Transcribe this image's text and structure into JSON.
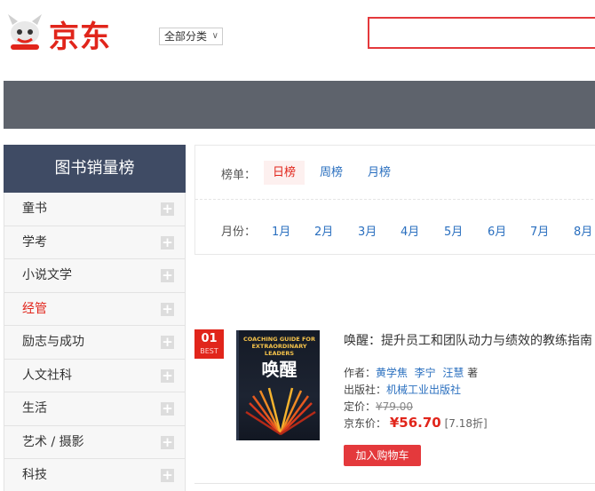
{
  "header": {
    "logo_text": "京东",
    "category_select": "全部分类",
    "search_value": ""
  },
  "sidebar": {
    "title": "图书销量榜",
    "items": [
      {
        "label": "童书"
      },
      {
        "label": "学考"
      },
      {
        "label": "小说文学"
      },
      {
        "label": "经管"
      },
      {
        "label": "励志与成功"
      },
      {
        "label": "人文社科"
      },
      {
        "label": "生活"
      },
      {
        "label": "艺术 / 摄影"
      },
      {
        "label": "科技"
      }
    ],
    "active_index": 3
  },
  "filter": {
    "list_label": "榜单：",
    "tabs": [
      "日榜",
      "周榜",
      "月榜"
    ],
    "active_tab": "日榜",
    "month_label": "月份：",
    "months": [
      "1月",
      "2月",
      "3月",
      "4月",
      "5月",
      "6月",
      "7月",
      "8月"
    ]
  },
  "product": {
    "rank": "01",
    "rank_tag": "BEST",
    "cover_en": "COACHING GUIDE FOR EXTRAORDINARY LEADERS",
    "cover_cn": "唤醒",
    "title": "唤醒：提升员工和团队动力与绩效的教练指南",
    "author_label": "作者：",
    "authors": [
      "黄学焦",
      "李宁",
      "汪慧"
    ],
    "author_suffix": "著",
    "publisher_label": "出版社：",
    "publisher": "机械工业出版社",
    "list_price_label": "定价：",
    "list_price": "¥79.00",
    "jd_price_label": "京东价：",
    "jd_price": "¥56.70",
    "discount": "[7.18折]",
    "cart_button": "加入购物车"
  },
  "colors": {
    "brand_red": "#e1251b",
    "sidebar_header": "#3f4b64",
    "banner": "#5e636c",
    "link_blue": "#2a6fbf"
  }
}
